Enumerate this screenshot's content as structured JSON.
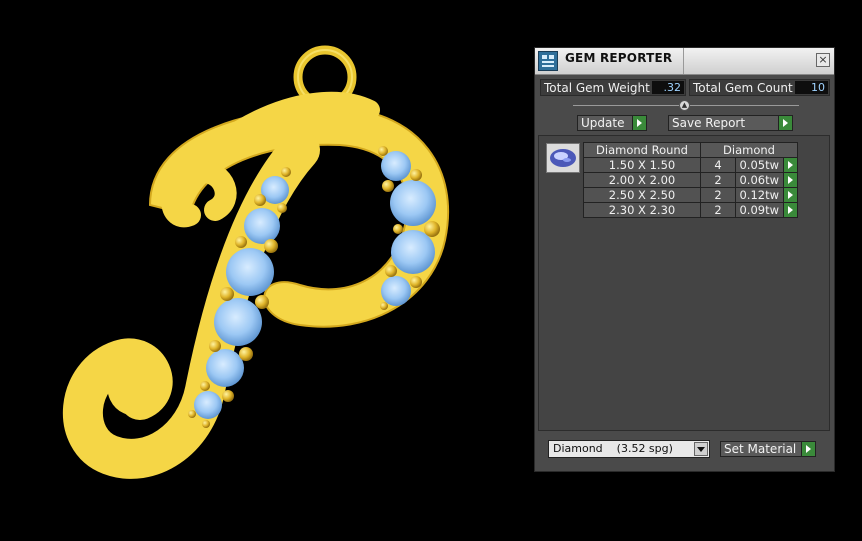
{
  "panel": {
    "title": "GEM REPORTER",
    "close_symbol": "×",
    "icons": {
      "app": "gem-reporter-icon",
      "close": "close-icon"
    }
  },
  "stats": {
    "weight_label": "Total Gem Weight",
    "weight_value": ".32",
    "count_label": "Total Gem Count",
    "count_value": "10"
  },
  "toolbar": {
    "update_label": "Update",
    "save_report_label": "Save Report"
  },
  "gem_table": {
    "col_shape": "Diamond Round",
    "col_material": "Diamond",
    "rows": [
      {
        "size": "1.50 X 1.50",
        "count": "4",
        "weight": "0.05tw"
      },
      {
        "size": "2.00 X 2.00",
        "count": "2",
        "weight": "0.06tw"
      },
      {
        "size": "2.50 X 2.50",
        "count": "2",
        "weight": "0.12tw"
      },
      {
        "size": "2.30 X 2.30",
        "count": "2",
        "weight": "0.09tw"
      }
    ]
  },
  "material": {
    "selected": "Diamond    (3.52 spg)",
    "set_label": "Set Material"
  },
  "colors": {
    "gold": "#f7d84a",
    "gem_blue": "#9cc8f4",
    "panel_bg": "#4a4a4a",
    "accent_green": "#3a8a3a"
  }
}
